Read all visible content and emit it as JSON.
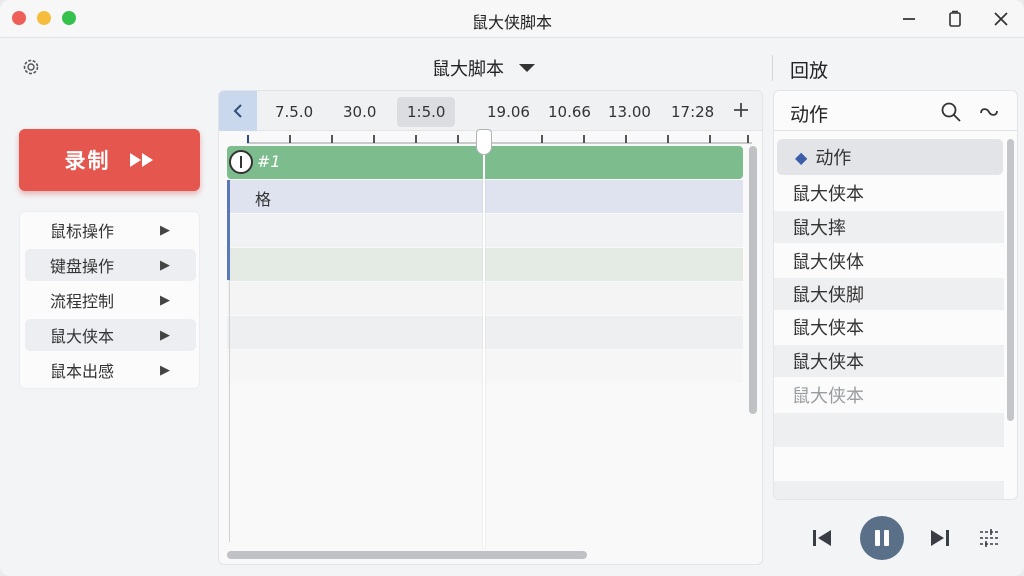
{
  "window": {
    "title": "鼠大侠脚本"
  },
  "record": {
    "label": "录制"
  },
  "sidebar": {
    "items": [
      {
        "label": "鼠标操作"
      },
      {
        "label": "键盘操作"
      },
      {
        "label": "流程控制"
      },
      {
        "label": "鼠大侠本"
      },
      {
        "label": "鼠本出感"
      }
    ]
  },
  "script": {
    "title": "鼠大脚本"
  },
  "replay": {
    "title": "回放"
  },
  "timeline": {
    "ticks": [
      "7.5.0",
      "30.0",
      "1:5.0",
      "19.06",
      "10.66",
      "13.00",
      "17:28"
    ],
    "selected_tick_index": 2,
    "tracks": [
      {
        "label": "#1"
      },
      {
        "label": "格"
      }
    ],
    "playhead_fraction": 0.47,
    "h_scroll_fraction": 0.66
  },
  "actions": {
    "title": "动作",
    "header_item": "动作",
    "items": [
      {
        "label": "鼠大侠本"
      },
      {
        "label": "鼠大摔"
      },
      {
        "label": "鼠大侠体"
      },
      {
        "label": "鼠大侠脚"
      },
      {
        "label": "鼠大侠本"
      },
      {
        "label": "鼠大侠本"
      },
      {
        "label": "鼠大侠本"
      }
    ]
  },
  "colors": {
    "record": "#e4564e",
    "track_green": "#7cbc8d",
    "track_blue": "#dfe3ef",
    "accent_blue": "#5a78b8",
    "pause_button": "#5a6f88"
  },
  "icons": {
    "settings": "gear-icon",
    "dropdown": "caret-down-icon",
    "back": "chevron-left-icon",
    "add": "plus-icon",
    "search": "search-icon",
    "link": "link-icon",
    "prev": "skip-previous-icon",
    "pause": "pause-icon",
    "next": "skip-next-icon",
    "adjust": "sliders-icon"
  }
}
